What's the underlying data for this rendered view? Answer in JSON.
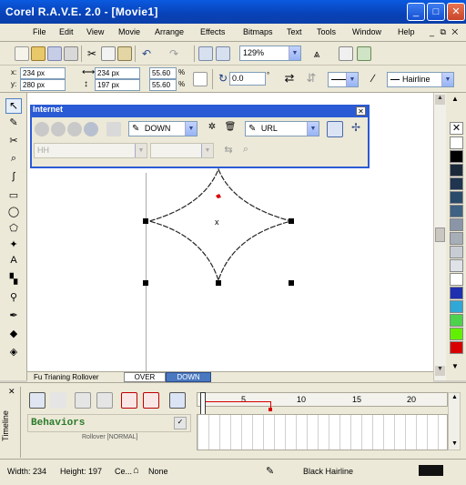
{
  "window": {
    "title": "Corel R.A.V.E. 2.0 - [Movie1]",
    "buttons": {
      "minimize": "_",
      "maximize": "□",
      "close": "✕"
    }
  },
  "menu": {
    "items": [
      "File",
      "Edit",
      "View",
      "Movie",
      "Arrange",
      "Effects",
      "Bitmaps",
      "Text",
      "Tools",
      "Window",
      "Help"
    ],
    "doc_controls": "_ ⧉ ✕"
  },
  "toolbar": {
    "zoom_value": "129%"
  },
  "propbar": {
    "x_pos": "234 px",
    "y_pos": "280 px",
    "width": "234 px",
    "height": "197 px",
    "scale_x": "55.60",
    "scale_y": "55.60",
    "pct_sign": "%",
    "rotation": "0.0",
    "degree": "°",
    "outline_width": "Hairline"
  },
  "internet_toolbar": {
    "title": "Internet",
    "state_select": "DOWN",
    "url_select": "URL",
    "target_select": "HH"
  },
  "docbar": {
    "label": "Fu Trianing Rollover",
    "tabs": [
      "OVER",
      "DOWN"
    ]
  },
  "timeline": {
    "vertical_label": "Timeline",
    "behaviors_label": "Behaviors",
    "ruler_ticks": [
      "5",
      "10",
      "15",
      "20"
    ],
    "row_text": "Rollover [NORMAL]"
  },
  "status": {
    "width_label": "Width: 234",
    "height_label": "Height: 197",
    "center_text": "Ce...",
    "fill_text": "None",
    "outline_text": "Black Hairline",
    "outline_color": "#111111"
  },
  "palette": {
    "colors": [
      "#ffffff",
      "#000000",
      "#1a2a3a",
      "#1f3550",
      "#2a4b6b",
      "#3d6283",
      "#8a96a8",
      "#a6aeb8",
      "#c8cdd3",
      "#dfe2e6",
      "#ffffff",
      "#1e2fb0",
      "#2fa8d8",
      "#4cd24c",
      "#63f000",
      "#d80000"
    ]
  }
}
